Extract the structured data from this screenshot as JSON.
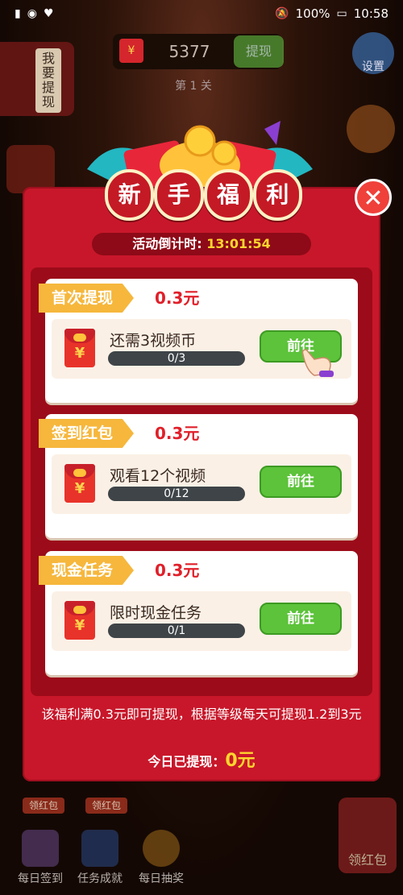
{
  "status_bar": {
    "battery": "100%",
    "time": "10:58"
  },
  "header": {
    "coins": "5377",
    "withdraw_label": "提现",
    "level": "第 1 关",
    "settings_label": "设置",
    "want_withdraw": "我要提现"
  },
  "modal": {
    "title_chars": [
      "新",
      "手",
      "福",
      "利"
    ],
    "countdown_label": "活动倒计时:",
    "countdown_value": "13:01:54",
    "tasks": [
      {
        "tag": "首次提现",
        "reward": "0.3元",
        "title": "还需3视频币",
        "progress": "0/3",
        "button": "前往"
      },
      {
        "tag": "签到红包",
        "reward": "0.3元",
        "title": "观看12个视频",
        "progress": "0/12",
        "button": "前往"
      },
      {
        "tag": "现金任务",
        "reward": "0.3元",
        "title": "限时现金任务",
        "progress": "0/1",
        "button": "前往"
      }
    ],
    "footnote": "该福利满0.3元即可提现，根据等级每天可提现1.2到3元",
    "today_label": "今日已提现：",
    "today_amount": "0元"
  },
  "dock": {
    "items": [
      {
        "badge": "领红包",
        "label": "每日签到"
      },
      {
        "badge": "领红包",
        "label": "任务成就"
      },
      {
        "label": "每日抽奖"
      }
    ],
    "big_redpack_label": "领红包"
  },
  "icons": {
    "close": "close-icon",
    "wallet": "red-envelope-icon",
    "settings": "gear-icon",
    "hand": "pointing-hand-icon"
  },
  "colors": {
    "modal_red": "#c8172a",
    "tag_orange": "#f6b73c",
    "go_green": "#5cc33a",
    "countdown_yellow": "#ffd62e"
  }
}
